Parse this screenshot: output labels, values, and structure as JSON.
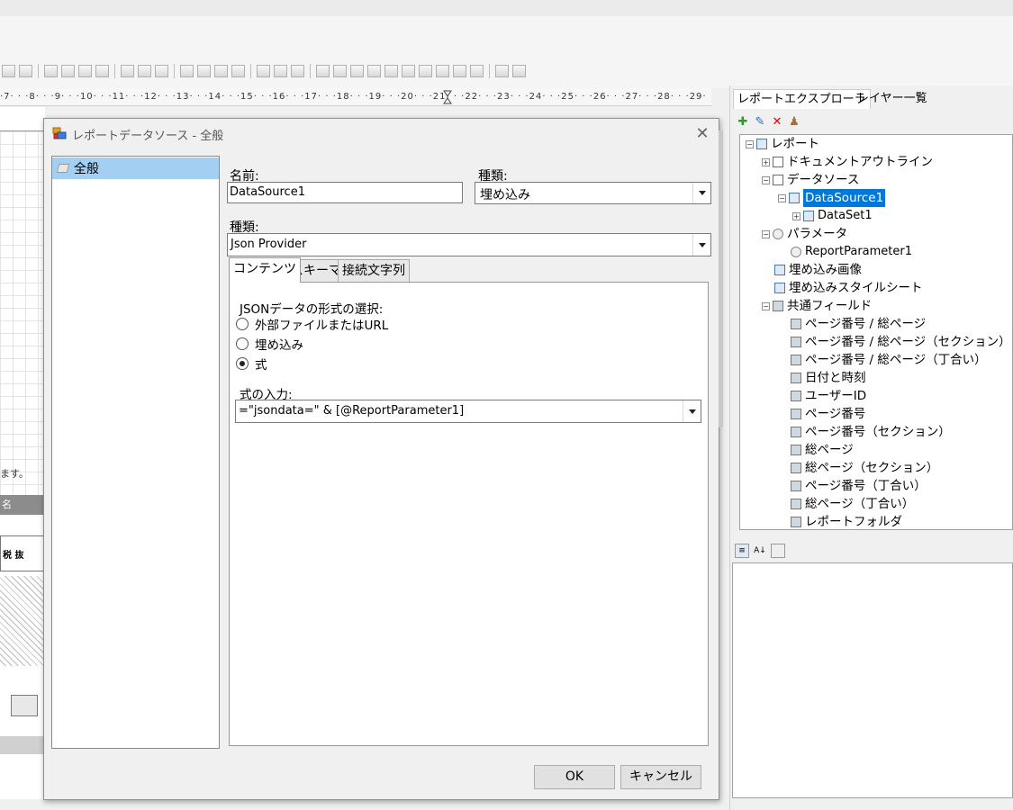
{
  "ruler": {
    "ticks": "·7· · ·8· · ·9· · ·10· · ·11· · ·12· · ·13· · ·14· · ·15· · ·16· · ·17· · ·18· · ·19· · ·20· · ·21· · ·22· · ·23· · ·24· · ·25· · ·26· · ·27· · ·28· · ·29·"
  },
  "designer_background": {
    "text_fragment": "ます。",
    "header_fragment": "名",
    "row_fragment": "税 抜"
  },
  "right_panel": {
    "tabs": [
      "レポートエクスプローラ",
      "レイヤー一覧"
    ],
    "tree": [
      {
        "label": "レポート"
      },
      {
        "label": "ドキュメントアウトライン"
      },
      {
        "label": "データソース"
      },
      {
        "label": "DataSource1"
      },
      {
        "label": "DataSet1"
      },
      {
        "label": "パラメータ"
      },
      {
        "label": "ReportParameter1"
      },
      {
        "label": "埋め込み画像"
      },
      {
        "label": "埋め込みスタイルシート"
      },
      {
        "label": "共通フィールド"
      },
      {
        "label": "ページ番号 / 総ページ"
      },
      {
        "label": "ページ番号 / 総ページ（セクション）"
      },
      {
        "label": "ページ番号 / 総ページ（丁合い）"
      },
      {
        "label": "日付と時刻"
      },
      {
        "label": "ユーザーID"
      },
      {
        "label": "ページ番号"
      },
      {
        "label": "ページ番号（セクション）"
      },
      {
        "label": "総ページ"
      },
      {
        "label": "総ページ（セクション）"
      },
      {
        "label": "ページ番号（丁合い）"
      },
      {
        "label": "総ページ（丁合い）"
      },
      {
        "label": "レポートフォルダ"
      }
    ],
    "prop_sort_label": "A↓"
  },
  "dialog": {
    "title": "レポートデータソース - 全般",
    "close_glyph": "✕",
    "nav_items": [
      "全般"
    ],
    "name_label": "名前:",
    "name_value": "DataSource1",
    "kind_label": "種類:",
    "kind_value": "埋め込み",
    "provider_label": "種類:",
    "provider_value": "Json Provider",
    "tabs": [
      "コンテンツ",
      "スキーマ",
      "接続文字列"
    ],
    "json_format_label": "JSONデータの形式の選択:",
    "radio_options": [
      {
        "label": "外部ファイルまたはURL",
        "checked": false
      },
      {
        "label": "埋め込み",
        "checked": false
      },
      {
        "label": "式",
        "checked": true
      }
    ],
    "expr_label": "式の入力:",
    "expr_value": "=\"jsondata=\" & [@ReportParameter1]",
    "ok_label": "OK",
    "cancel_label": "キャンセル"
  },
  "colors": {
    "selection": "#0078d7",
    "nav_selected": "#a3cff2"
  }
}
